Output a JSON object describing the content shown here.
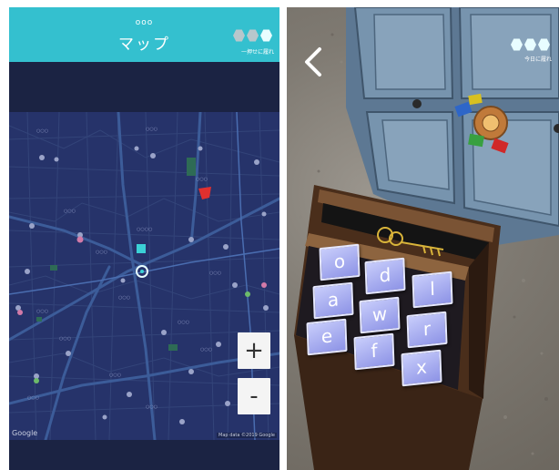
{
  "map_screen": {
    "header": {
      "small_label": "ooo",
      "title": "マップ",
      "progress_caption": "一押せに履れ"
    },
    "progress": {
      "filled": 1,
      "total": 3
    },
    "map": {
      "provider_mark": "Google",
      "attribution": "Map data ©2019 Google"
    },
    "zoom": {
      "in_label": "+",
      "out_label": "-"
    },
    "colors": {
      "header": "#34c0cf",
      "background": "#1b2343",
      "map_base": "#26336a",
      "road": "#3c5c99",
      "pin_current": "#3bd1d6",
      "pin_target": "#e0302f"
    },
    "icons": [
      "location-pin-icon",
      "target-pin-icon",
      "plus-icon",
      "minus-icon"
    ]
  },
  "ar_screen": {
    "back_icon": "chevron-left-icon",
    "progress": {
      "filled": 3,
      "total": 3
    },
    "progress_caption": "今日に履れ",
    "keypad": {
      "keys": [
        "o",
        "d",
        "l",
        "a",
        "w",
        "r",
        "e",
        "f",
        "x"
      ]
    },
    "colors": {
      "key_fill": "#a5abf0",
      "key_border": "#e6e8ff",
      "box_wood": "#5a3a22",
      "cabinet": "#6d88a2",
      "key_emblem": "#d9b43a"
    }
  }
}
